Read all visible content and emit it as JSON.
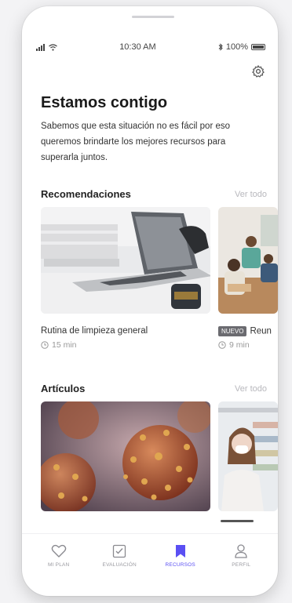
{
  "status_bar": {
    "time": "10:30 AM",
    "battery": "100%"
  },
  "header": {
    "title": "Estamos contigo"
  },
  "intro": {
    "text": "Sabemos que esta situación no es fácil por eso queremos brindarte los mejores recursos para superarla juntos."
  },
  "recommendations": {
    "heading": "Recomendaciones",
    "see_all": "Ver todo",
    "items": [
      {
        "title": "Rutina de limpieza general",
        "duration": "15 min"
      },
      {
        "badge": "NUEVO",
        "title": "Reun",
        "duration": "9 min"
      }
    ]
  },
  "articles": {
    "heading": "Artículos",
    "see_all": "Ver todo"
  },
  "tabbar": {
    "items": [
      {
        "label": "MI PLAN"
      },
      {
        "label": "EVALUACIÓN"
      },
      {
        "label": "RECURSOS"
      },
      {
        "label": "PERFIL"
      }
    ]
  },
  "colors": {
    "accent": "#5a4ff3"
  }
}
